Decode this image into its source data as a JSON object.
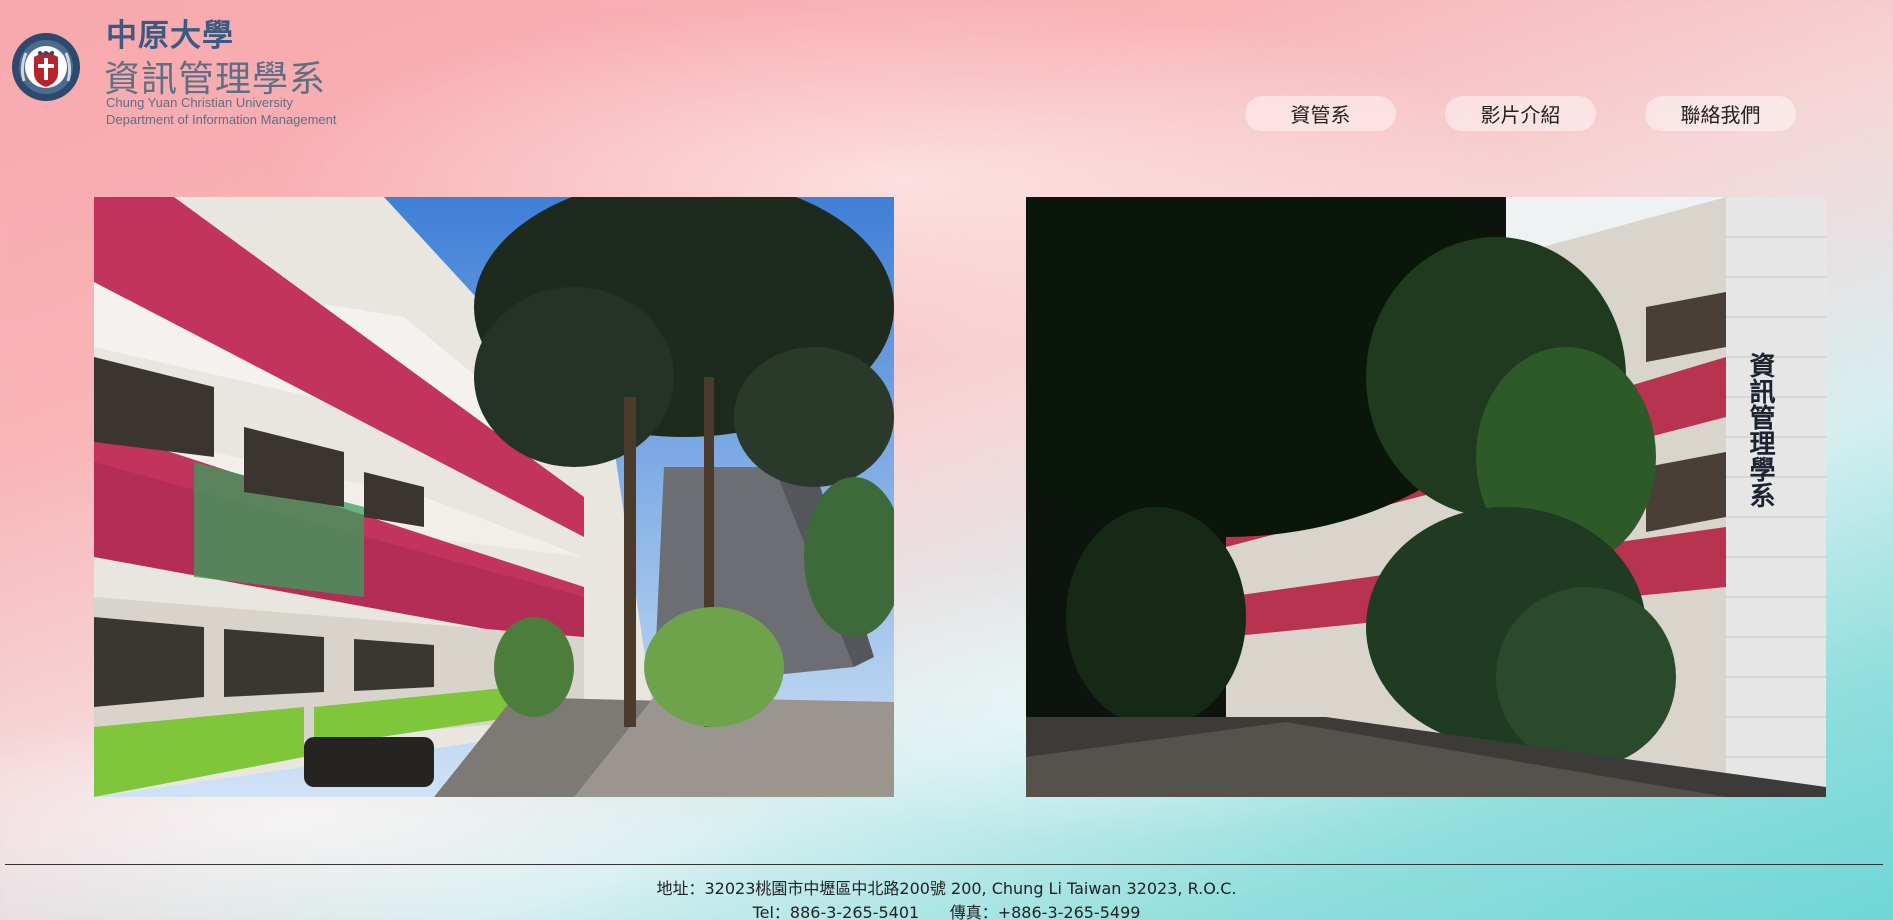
{
  "header": {
    "logo_cn_university": "中原大學",
    "logo_cn_department": "資訊管理學系",
    "logo_en_university": "Chung Yuan Christian University",
    "logo_en_department": "Department of Information Management",
    "logo_icon": "university-seal-icon"
  },
  "nav": {
    "items": [
      {
        "label": "資管系"
      },
      {
        "label": "影片介紹"
      },
      {
        "label": "聯絡我們"
      }
    ]
  },
  "photos": {
    "left": {
      "name": "campus-building-photo-left"
    },
    "right": {
      "name": "campus-building-photo-right"
    },
    "building_sign": "資訊管理學系"
  },
  "footer": {
    "address": "地址：32023桃園市中壢區中北路200號 200, Chung Li Taiwan 32023, R.O.C.",
    "phone": "Tel：886-3-265-5401      傳真：+886-3-265-5499"
  },
  "colors": {
    "bg_top": "#f7a8ad",
    "bg_bottom": "#6fd6d6",
    "logo_blue": "#3b5a82",
    "building_red": "#c2335e",
    "building_green": "#7fc63a"
  }
}
